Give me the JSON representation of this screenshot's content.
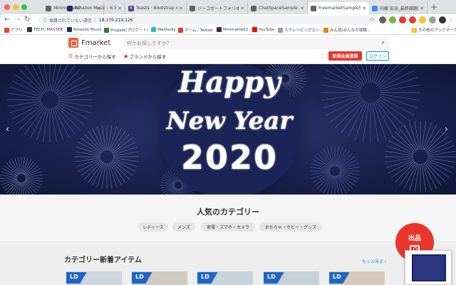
{
  "browser": {
    "tabs": [
      {
        "label": "Minimaltalk2",
        "favicon_color": "#5f6368"
      },
      {
        "label": "Amazon Music - 6,500",
        "favicon_color": "#1a2a6c"
      },
      {
        "label": "Toasts · Bootstrap 4.2",
        "favicon_color": "#563d7c"
      },
      {
        "label": "ジーコポートフォリオ",
        "favicon_color": "#5f6368"
      },
      {
        "label": "ChatSpaceSample",
        "favicon_color": "#5f6368"
      },
      {
        "label": "FreemarketSample55b",
        "favicon_color": "#5f6368",
        "active": true
      },
      {
        "label": "内藤 宏治_最終課題説明",
        "favicon_color": "#4285f4"
      }
    ],
    "new_tab": "+",
    "security_text": "保護されていない通信",
    "url": "18.179.219.126",
    "bookmarks": [
      {
        "label": "アプリ",
        "color": "#ea4335"
      },
      {
        "label": "TECH::MASTER",
        "color": "#333333"
      },
      {
        "label": "Amazon Music",
        "color": "#1a2a6c"
      },
      {
        "label": "Progate(プログート)",
        "color": "#2e7d32"
      },
      {
        "label": "Wantedly",
        "color": "#21bddb"
      },
      {
        "label": "ホーム / Twitter",
        "color": "#e53935"
      },
      {
        "label": "Minimaltalk2",
        "color": "#333333"
      },
      {
        "label": "YouTube",
        "color": "#ff0000"
      },
      {
        "label": "スクレイピングエン...",
        "color": "#9e9e9e"
      },
      {
        "label": "みん就(みんなの就職...",
        "color": "#f57c00"
      },
      {
        "label": "その他のブックマーク",
        "color": "#fbc02d"
      }
    ]
  },
  "site": {
    "logo_text": "Fmarket",
    "search_placeholder": "何かお探しですか？",
    "category_link": "カテゴリーから探す",
    "brand_link": "ブランドから探す",
    "register_button": "新規会員登録",
    "login_button": "ログイン"
  },
  "hero": {
    "line1": "Happy",
    "line2": "New Year",
    "line3": "2020",
    "prev_arrow": "‹",
    "next_arrow": "›"
  },
  "popular": {
    "title": "人気のカテゴリー",
    "chips": [
      "レディース",
      "メンズ",
      "家電・スマホ・カメラ",
      "おもちゃ・ホビー・グッズ"
    ]
  },
  "new_items": {
    "title": "カテゴリー新着アイテム",
    "more_link": "もっと見る ›",
    "sold_label": "LD"
  },
  "sell_button": {
    "label": "出品"
  },
  "colors": {
    "accent_red": "#ea352d",
    "link_blue": "#0095ee",
    "sold_blue": "#1f66c4"
  }
}
